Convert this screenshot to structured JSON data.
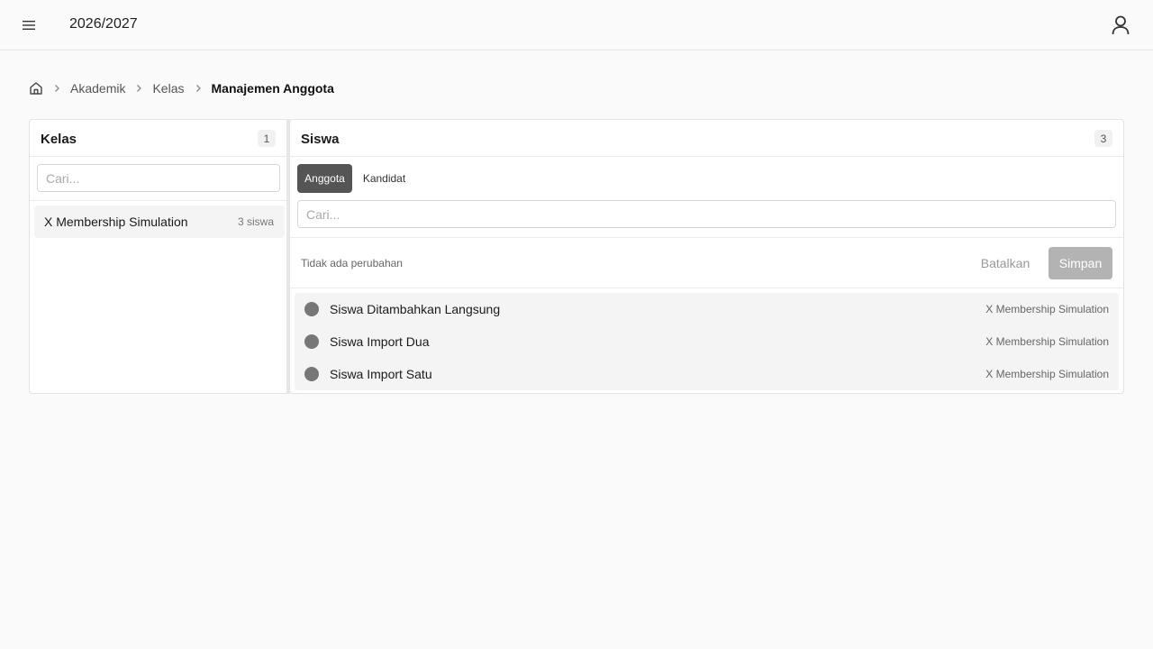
{
  "header": {
    "menu_icon": "hamburger-menu-icon",
    "academic_year": "2026/2027",
    "user_icon": "user-icon"
  },
  "breadcrumb": {
    "home_icon": "home-icon",
    "items": [
      "Akademik",
      "Kelas"
    ],
    "current": "Manajemen Anggota"
  },
  "classes_panel": {
    "title": "Kelas",
    "count": "1",
    "search_placeholder": "Cari...",
    "items": [
      {
        "name": "X Membership Simulation",
        "meta": "3 siswa"
      }
    ]
  },
  "students_panel": {
    "title": "Siswa",
    "count": "3",
    "tabs": [
      {
        "label": "Anggota",
        "active": true
      },
      {
        "label": "Kandidat",
        "active": false
      }
    ],
    "search_placeholder": "Cari...",
    "status_text": "Tidak ada perubahan",
    "cancel_label": "Batalkan",
    "save_label": "Simpan",
    "students": [
      {
        "name": "Siswa Ditambahkan Langsung",
        "class": "X Membership Simulation"
      },
      {
        "name": "Siswa Import Dua",
        "class": "X Membership Simulation"
      },
      {
        "name": "Siswa Import Satu",
        "class": "X Membership Simulation"
      }
    ]
  },
  "colors": {
    "active_tab": "#555555",
    "save_disabled": "#b3b3b3",
    "student_dot": "#777777"
  }
}
